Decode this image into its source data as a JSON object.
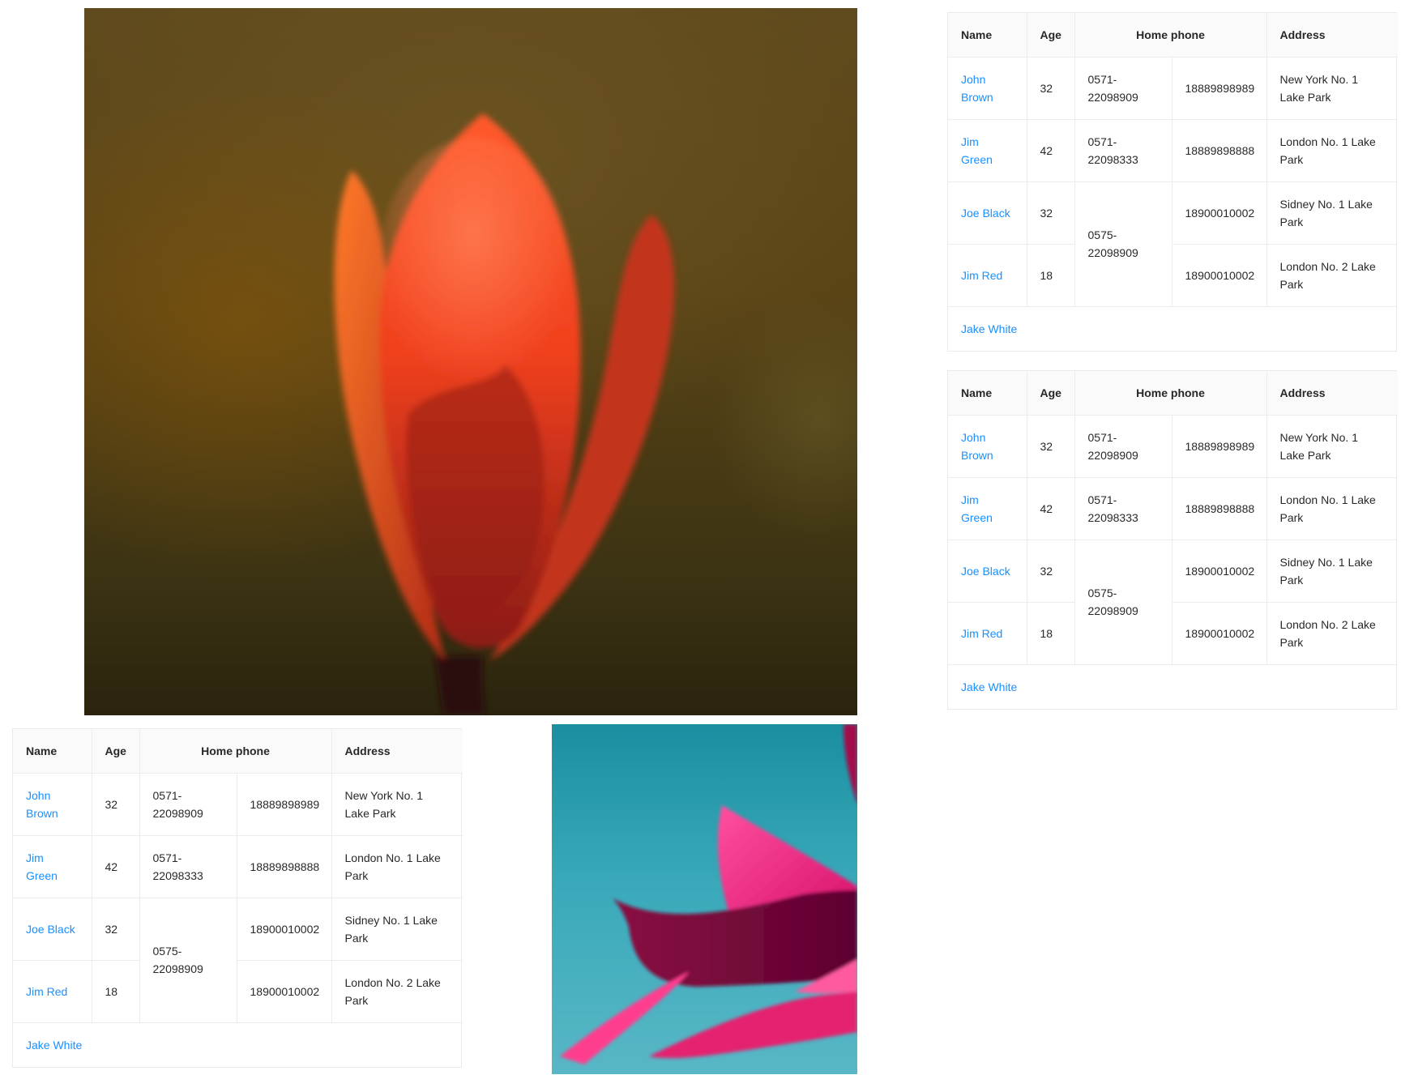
{
  "columns": {
    "name": "Name",
    "age": "Age",
    "home_phone": "Home phone",
    "address": "Address"
  },
  "rows": [
    {
      "name": "John Brown",
      "age": "32",
      "tel": "0571-22098909",
      "phone": "18889898989",
      "address": "New York No. 1 Lake Park"
    },
    {
      "name": "Jim Green",
      "age": "42",
      "tel": "0571-22098333",
      "phone": "18889898888",
      "address": "London No. 1 Lake Park"
    },
    {
      "name": "Joe Black",
      "age": "32",
      "tel": "0575-22098909",
      "phone": "18900010002",
      "address": "Sidney No. 1 Lake Park"
    },
    {
      "name": "Jim Red",
      "age": "18",
      "phone": "18900010002",
      "address": "London No. 2 Lake Park"
    }
  ],
  "footer_row": {
    "name": "Jake White"
  },
  "colors": {
    "link": "#1890ff",
    "header_bg": "#fafafa",
    "border": "#ececec"
  }
}
